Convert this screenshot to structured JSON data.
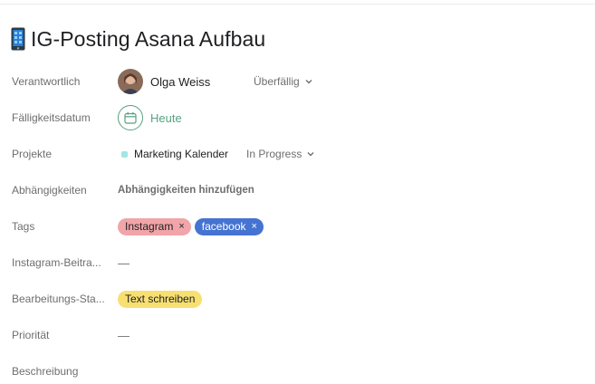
{
  "task": {
    "emoji_icon": "mobile-phone-icon",
    "title": "IG-Posting Asana Aufbau"
  },
  "fields": {
    "assignee": {
      "label": "Verantwortlich",
      "name": "Olga Weiss",
      "status": "Überfällig"
    },
    "due_date": {
      "label": "Fälligkeitsdatum",
      "value": "Heute"
    },
    "projects": {
      "label": "Projekte",
      "project_name": "Marketing Kalender",
      "section": "In Progress",
      "dot_color": "#9ee7e3"
    },
    "dependencies": {
      "label": "Abhängigkeiten",
      "action": "Abhängigkeiten hinzufügen"
    },
    "tags": {
      "label": "Tags",
      "items": [
        {
          "name": "Instagram",
          "remove": "×",
          "color": "#f1a5a8"
        },
        {
          "name": "facebook",
          "remove": "×",
          "color": "#4573d2"
        }
      ]
    },
    "instagram_post": {
      "label": "Instagram-Beitra...",
      "value": "—"
    },
    "edit_status": {
      "label": "Bearbeitungs-Sta...",
      "value": "Text schreiben",
      "color": "#f8df72"
    },
    "priority": {
      "label": "Priorität",
      "value": "—"
    },
    "description": {
      "label": "Beschreibung"
    }
  },
  "colors": {
    "accent_green": "#58a182",
    "label_gray": "#6d6e6f"
  }
}
